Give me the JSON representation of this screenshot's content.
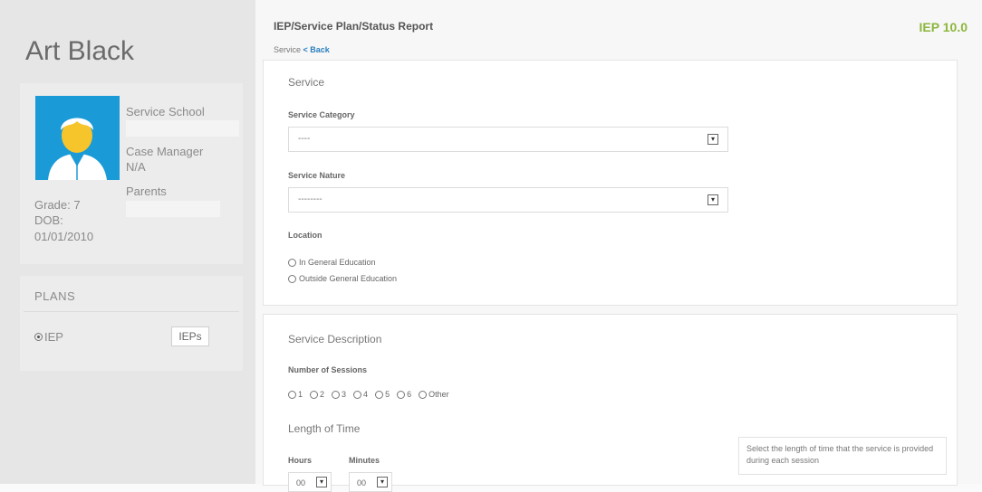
{
  "student": {
    "name": "Art Black",
    "service_school_label": "Service School",
    "case_manager_label": "Case Manager",
    "case_manager_value": "N/A",
    "parents_label": "Parents",
    "grade": "Grade: 7",
    "dob_label": "DOB:",
    "dob_value": "01/01/2010"
  },
  "plans": {
    "title": "PLANS",
    "iep_label": "IEP",
    "ieps_button": "IEPs"
  },
  "header": {
    "title": "IEP/Service Plan/Status Report",
    "version": "IEP 10.0",
    "breadcrumb_service": "Service",
    "breadcrumb_back": "< Back"
  },
  "service_section": {
    "title": "Service",
    "category_label": "Service Category",
    "category_value": "----",
    "nature_label": "Service Nature",
    "nature_value": "--------",
    "location_label": "Location",
    "location_options": [
      "In General Education",
      "Outside General Education"
    ]
  },
  "description_section": {
    "title": "Service Description",
    "sessions_label": "Number of Sessions",
    "session_options": [
      "1",
      "2",
      "3",
      "4",
      "5",
      "6",
      "Other"
    ],
    "length_title": "Length of Time",
    "hours_label": "Hours",
    "minutes_label": "Minutes",
    "hours_value": "00",
    "minutes_value": "00",
    "help_text": "Select the length of time that the service is provided during each session"
  },
  "colors": {
    "accent_green": "#8db63c",
    "link_blue": "#2a7fbd",
    "avatar_blue": "#1a9ad6"
  }
}
